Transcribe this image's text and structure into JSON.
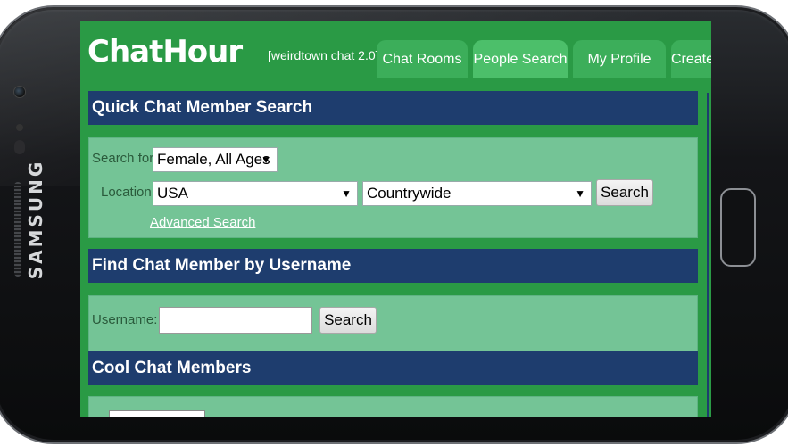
{
  "device": {
    "brand": "SAMSUNG"
  },
  "app": {
    "logo": "ChatHour",
    "tagline": "[weirdtown chat 2.0]"
  },
  "tabs": [
    {
      "label": "Chat Rooms"
    },
    {
      "label": "People Search"
    },
    {
      "label": "My Profile"
    },
    {
      "label": "Create a"
    }
  ],
  "quick_search": {
    "title": "Quick Chat Member Search",
    "search_for_label": "Search for:",
    "search_for_value": "Female, All Ages",
    "location_label": "Location:",
    "country_value": "USA",
    "region_value": "Countrywide",
    "search_button": "Search",
    "advanced_link": "Advanced Search"
  },
  "username_search": {
    "title": "Find Chat Member by Username",
    "username_label": "Username:",
    "username_value": "",
    "search_button": "Search"
  },
  "cool_members": {
    "title": "Cool Chat Members"
  },
  "colors": {
    "header_green": "#2a9a45",
    "tab_green": "#3cae5a",
    "section_navy": "#1e3d6e",
    "panel_green": "#74c496"
  },
  "icons": {
    "dropdown": "triangle-down-icon"
  }
}
